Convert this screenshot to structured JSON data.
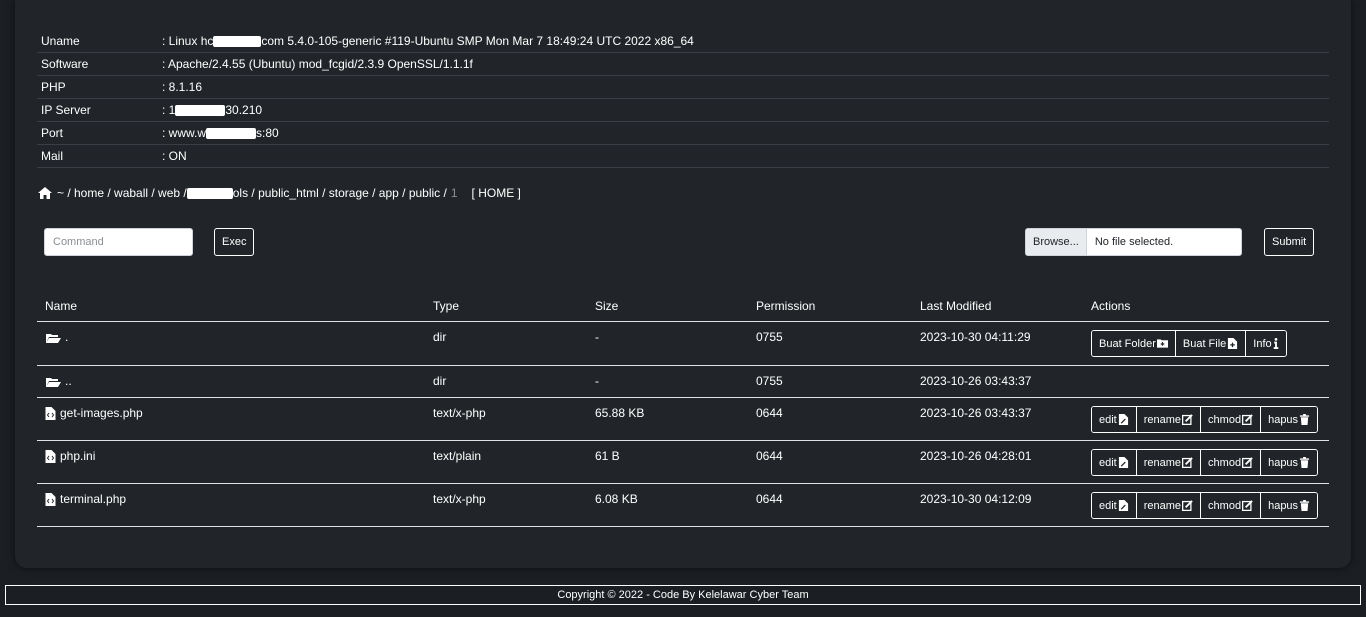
{
  "info": {
    "uname_label": "Uname",
    "uname_value_a": ": Linux hc",
    "uname_value_b": "com 5.4.0-105-generic #119-Ubuntu SMP Mon Mar 7 18:49:24 UTC 2022 x86_64",
    "software_label": "Software",
    "software_value": ": Apache/2.4.55 (Ubuntu) mod_fcgid/2.3.9 OpenSSL/1.1.1f",
    "php_label": "PHP",
    "php_value": ": 8.1.16",
    "ip_label": "IP Server",
    "ip_value_a": ": 1",
    "ip_value_b": "30.210",
    "port_label": "Port",
    "port_value_a": ": www.w",
    "port_value_b": "s:80",
    "mail_label": "Mail",
    "mail_value": ": ON"
  },
  "path": {
    "part1": "~ / home / waball / web / ",
    "part2": "ols / public_html / storage / app / public /",
    "current": "1",
    "home_link": "[ HOME ]"
  },
  "command": {
    "placeholder": "Command",
    "exec_label": "Exec"
  },
  "upload": {
    "browse_label": "Browse...",
    "file_status": "No file selected.",
    "submit_label": "Submit"
  },
  "table": {
    "headers": [
      "Name",
      "Type",
      "Size",
      "Permission",
      "Last Modified",
      "Actions"
    ],
    "rows": [
      {
        "name": ".",
        "type": "dir",
        "size": "-",
        "perm": "0755",
        "modified": "2023-10-30 04:11:29"
      },
      {
        "name": "..",
        "type": "dir",
        "size": "-",
        "perm": "0755",
        "modified": "2023-10-26 03:43:37"
      },
      {
        "name": "get-images.php",
        "type": "text/x-php",
        "size": "65.88 KB",
        "perm": "0644",
        "modified": "2023-10-26 03:43:37"
      },
      {
        "name": "php.ini",
        "type": "text/plain",
        "size": "61 B",
        "perm": "0644",
        "modified": "2023-10-26 04:28:01"
      },
      {
        "name": "terminal.php",
        "type": "text/x-php",
        "size": "6.08 KB",
        "perm": "0644",
        "modified": "2023-10-30 04:12:09"
      }
    ],
    "dir_actions": [
      "Buat Folder",
      "Buat File",
      "Info"
    ],
    "file_actions": [
      "edit",
      "rename",
      "chmod",
      "hapus"
    ]
  },
  "footer": "Copyright © 2022 - Code By Kelelawar Cyber Team",
  "colors": {
    "background": "#1b1f23",
    "panel": "#212529",
    "border": "#dee2e6",
    "text": "#ffffff"
  }
}
